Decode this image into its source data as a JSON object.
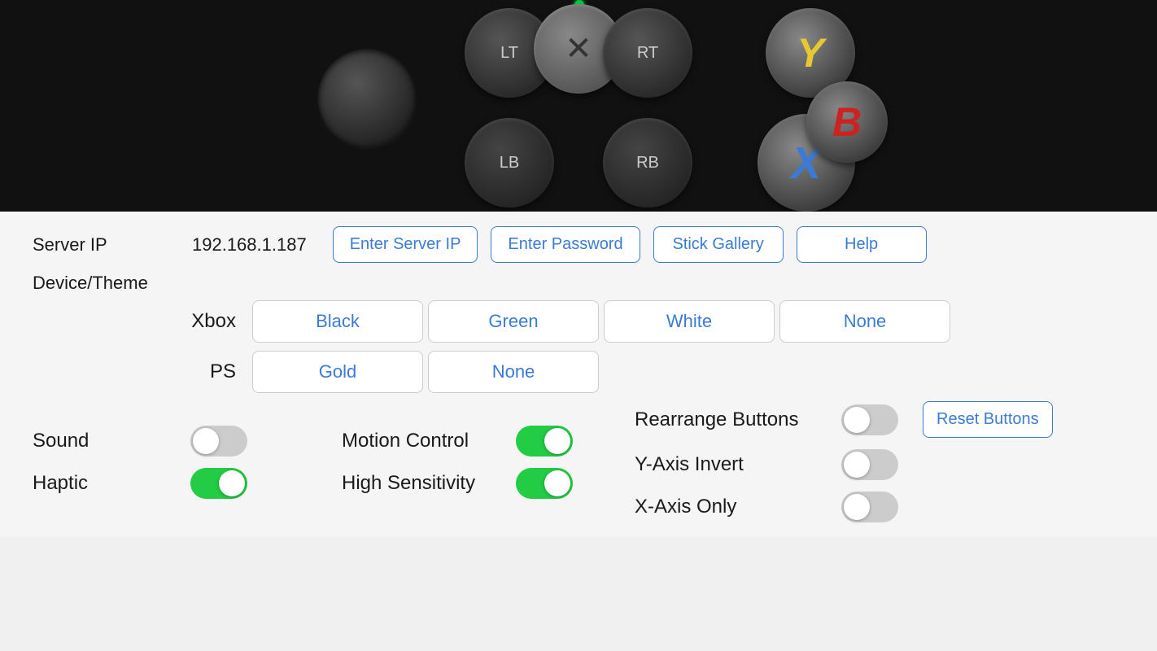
{
  "controller": {
    "led_color": "#00cc44",
    "buttons": {
      "lt": "LT",
      "rt": "RT",
      "lb": "LB",
      "rb": "RB",
      "y": "Y",
      "x": "X",
      "b": "B"
    }
  },
  "header": {
    "server_ip_label": "Server IP",
    "server_ip_value": "192.168.1.187",
    "enter_server_ip": "Enter Server IP",
    "enter_password": "Enter Password",
    "stick_gallery": "Stick Gallery",
    "help": "Help"
  },
  "device_theme": {
    "label": "Device/Theme",
    "xbox_label": "Xbox",
    "xbox_themes": [
      "Black",
      "Green",
      "White",
      "None"
    ],
    "ps_label": "PS",
    "ps_themes": [
      "Gold",
      "None"
    ]
  },
  "controls": {
    "sound_label": "Sound",
    "sound_on": false,
    "haptic_label": "Haptic",
    "haptic_on": true,
    "motion_control_label": "Motion Control",
    "motion_control_on": true,
    "high_sensitivity_label": "High Sensitivity",
    "high_sensitivity_on": true,
    "rearrange_buttons_label": "Rearrange Buttons",
    "rearrange_buttons_on": false,
    "reset_buttons_label": "Reset Buttons",
    "y_axis_invert_label": "Y-Axis Invert",
    "y_axis_invert_on": false,
    "x_axis_only_label": "X-Axis Only",
    "x_axis_only_on": false
  }
}
